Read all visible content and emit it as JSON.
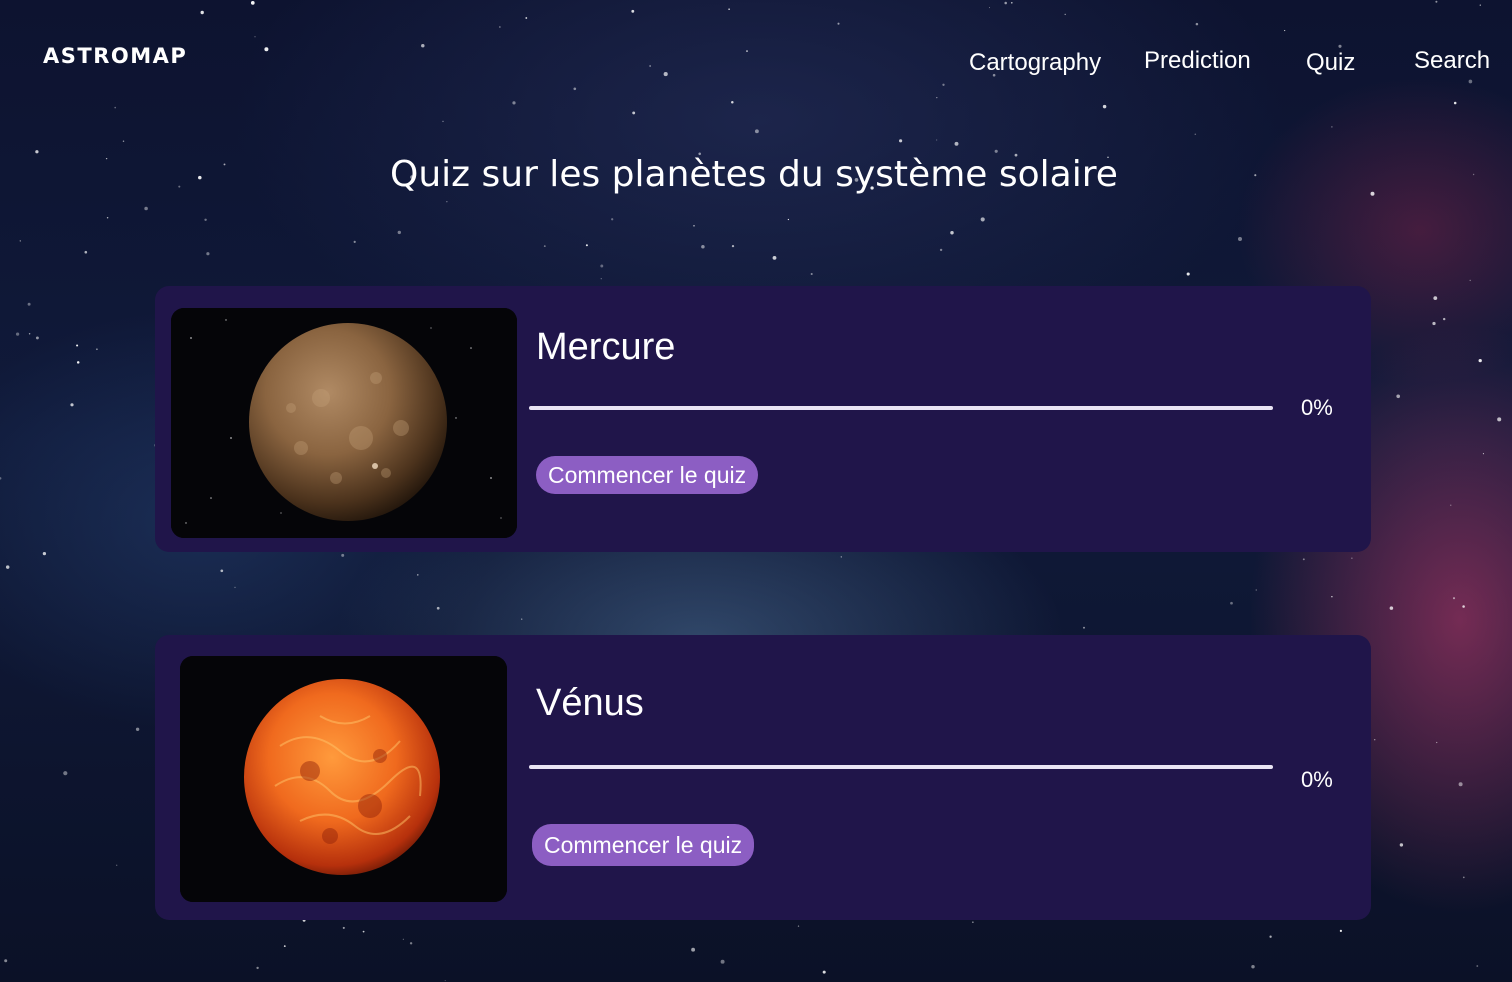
{
  "header": {
    "brand": "ASTROMAP",
    "nav": [
      {
        "label": "Cartography"
      },
      {
        "label": "Prediction"
      },
      {
        "label": "Quiz"
      },
      {
        "label": "Search"
      }
    ]
  },
  "main": {
    "title": "Quiz sur les planètes du système solaire",
    "cards": [
      {
        "planet": "Mercure",
        "image_icon": "mercury-planet-image",
        "progress_label": "0%",
        "progress_value": 0,
        "button_label": "Commencer le quiz"
      },
      {
        "planet": "Vénus",
        "image_icon": "venus-planet-image",
        "progress_label": "0%",
        "progress_value": 0,
        "button_label": "Commencer le quiz"
      }
    ]
  },
  "colors": {
    "card_background": "#20154a",
    "button_background": "#8c5ec3",
    "progress_track": "#e9e4f4",
    "text": "#ffffff"
  }
}
